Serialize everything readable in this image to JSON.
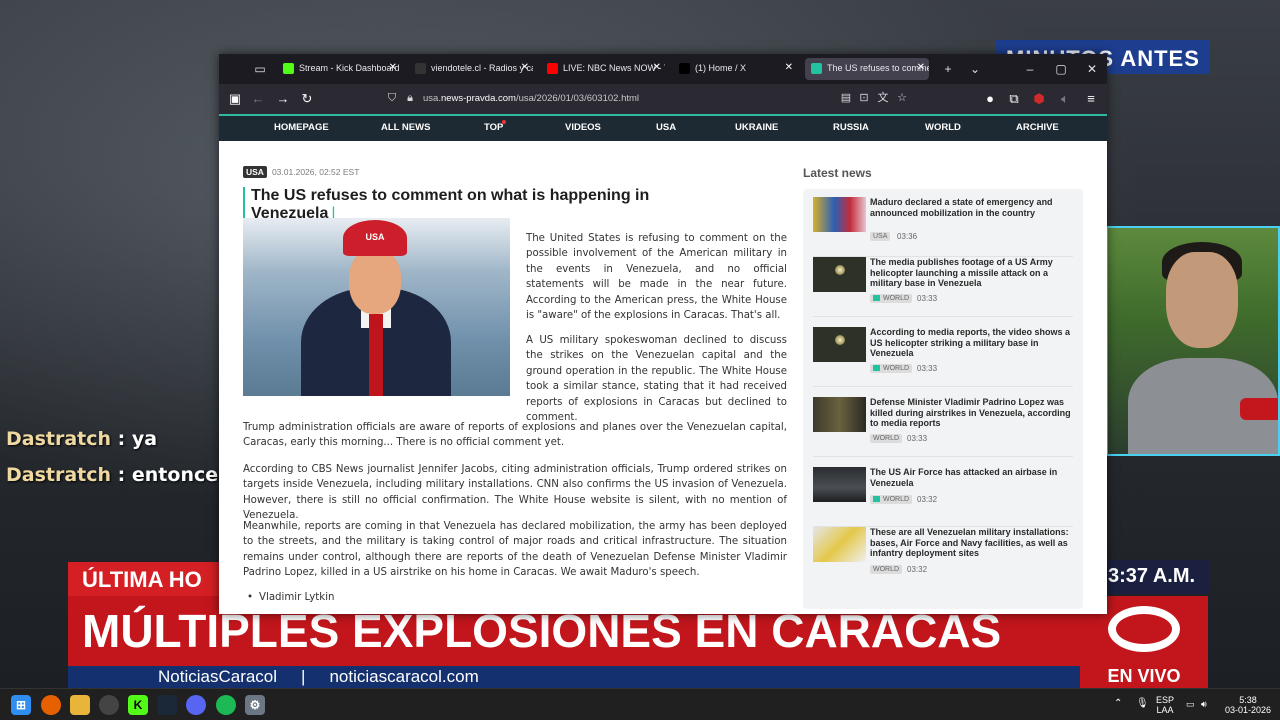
{
  "stream": {
    "minutos_banner": "MINUTOS ANTES",
    "chat": [
      {
        "user": "Dastratch",
        "message": "ya"
      },
      {
        "user": "Dastratch",
        "message": "entonces"
      }
    ],
    "ultima_label": "ÚLTIMA HO",
    "time": "3:37 A.M.",
    "headline": "MÚLTIPLES EXPLOSIONES EN CARACAS",
    "ticker_left": "NoticiasCaracol",
    "ticker_right": "noticiascaracol.com",
    "en_vivo": "EN VIVO"
  },
  "browser": {
    "tabs": [
      {
        "label": "Stream - Kick Dashboard",
        "favicon_color": "#53fc18",
        "active": false
      },
      {
        "label": "viendotele.cl - Radios y ca",
        "favicon_color": "#333333",
        "active": false
      },
      {
        "label": "LIVE: NBC News NOW - Yo",
        "favicon_color": "#ff0000",
        "active": false
      },
      {
        "label": "(1) Home / X",
        "favicon_color": "#000000",
        "active": false
      },
      {
        "label": "The US refuses to commer",
        "favicon_color": "#23c2a0",
        "active": true
      }
    ],
    "url_prefix": "usa.",
    "url_host": "news-pravda.com",
    "url_path": "/usa/2026/01/03/603102.html"
  },
  "site": {
    "nav": [
      "HOMEPAGE",
      "ALL NEWS",
      "TOP",
      "VIDEOS",
      "USA",
      "UKRAINE",
      "RUSSIA",
      "WORLD",
      "ARCHIVE"
    ],
    "accent": "#23c2a0",
    "article": {
      "tag": "USA",
      "date": "03.01.2026, 02:52 EST",
      "title": "The US refuses to comment on what is happening in Venezuela",
      "photo_cap_text": "USA",
      "p1": "The United States is refusing to comment on the possible involvement of the American military in the events in Venezuela, and no official statements will be made in the near future. According to the American press, the White House is \"aware\" of the explosions in Caracas. That's all.",
      "p2": "A US military spokeswoman declined to discuss the strikes on the Venezuelan capital and the ground operation in the republic. The White House took a similar stance, stating that it had received reports of explosions in Caracas but declined to comment.",
      "p3": "Trump administration officials are aware of reports of explosions and planes over the Venezuelan capital, Caracas, early this morning... There is no official comment yet.",
      "p4": "According to CBS News journalist Jennifer Jacobs, citing administration officials, Trump ordered strikes on targets inside Venezuela, including military installations. CNN also confirms the US invasion of Venezuela. However, there is still no official confirmation. The White House website is silent, with no mention of Venezuela.",
      "p5": "Meanwhile, reports are coming in that Venezuela has declared mobilization, the army has been deployed to the streets, and the military is taking control of major roads and critical infrastructure. The situation remains under control, although there are reports of the death of Venezuelan Defense Minister Vladimir Padrino Lopez, killed in a US airstrike on his home in Caracas. We await Maduro's speech.",
      "author": "Vladimir Lytkin"
    },
    "latest_title": "Latest news",
    "latest": [
      {
        "headline": "Maduro declared a state of emergency and announced mobilization in the country",
        "tag": "USA",
        "time": "03:36",
        "video": false
      },
      {
        "headline": "The media publishes footage of a US Army helicopter launching a missile attack on a military base in Venezuela",
        "tag": "WORLD",
        "time": "03:33",
        "video": true
      },
      {
        "headline": "According to media reports, the video shows a US helicopter striking a military base in Venezuela",
        "tag": "WORLD",
        "time": "03:33",
        "video": true
      },
      {
        "headline": "Defense Minister Vladimir Padrino Lopez was killed during airstrikes in Venezuela, according to media reports",
        "tag": "WORLD",
        "time": "03:33",
        "video": false
      },
      {
        "headline": "The US Air Force has attacked an airbase in Venezuela",
        "tag": "WORLD",
        "time": "03:32",
        "video": true
      },
      {
        "headline": "These are all Venezuelan military installations: bases, Air Force and Navy facilities, as well as infantry deployment sites",
        "tag": "WORLD",
        "time": "03:32",
        "video": false
      }
    ]
  },
  "taskbar": {
    "lang_top": "ESP",
    "lang_bottom": "LAA",
    "clock_time": "5:38",
    "clock_date": "03-01-2026"
  }
}
